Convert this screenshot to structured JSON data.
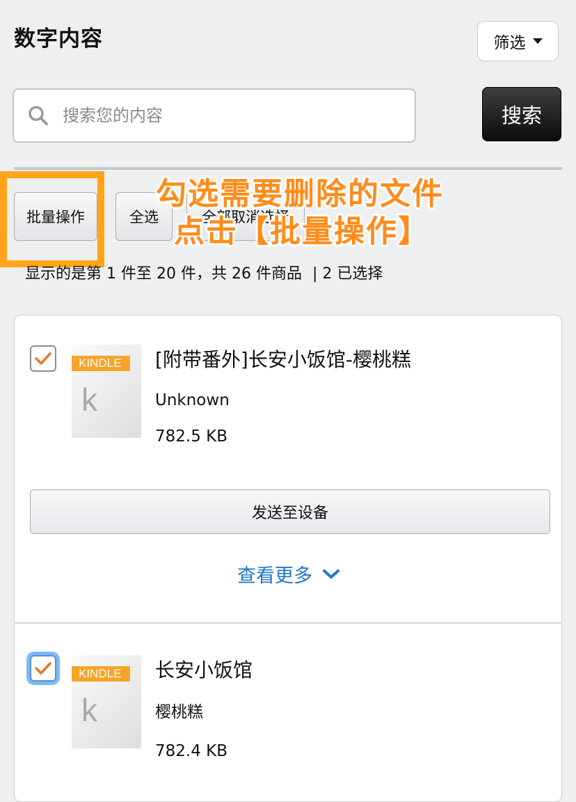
{
  "header": {
    "title": "数字内容",
    "filter_label": "筛选"
  },
  "search": {
    "placeholder": "搜索您的内容",
    "value": "",
    "button_label": "搜索"
  },
  "actions": {
    "batch": "批量操作",
    "select_all": "全选",
    "deselect_all": "全部取消选择"
  },
  "overlay": {
    "line1": "勾选需要删除的文件",
    "line2": "点击【批量操作】"
  },
  "status": {
    "range": "显示的是第 1 件至 20 件，共 26 件商品",
    "selected": "| 2 已选择"
  },
  "items": [
    {
      "badge": "KINDLE",
      "letter": "k",
      "title": "[附带番外]长安小饭馆-樱桃糕",
      "author": "Unknown",
      "size": "782.5 KB",
      "checked": true,
      "send_label": "发送至设备",
      "more_label": "查看更多"
    },
    {
      "badge": "KINDLE",
      "letter": "k",
      "title": "长安小饭馆",
      "author": "樱桃糕",
      "size": "782.4 KB",
      "checked": true
    }
  ],
  "colors": {
    "accent_orange": "#ff8c1a",
    "highlight": "#ffa517",
    "link_blue": "#1f77c9",
    "check_orange": "#e8762b"
  }
}
